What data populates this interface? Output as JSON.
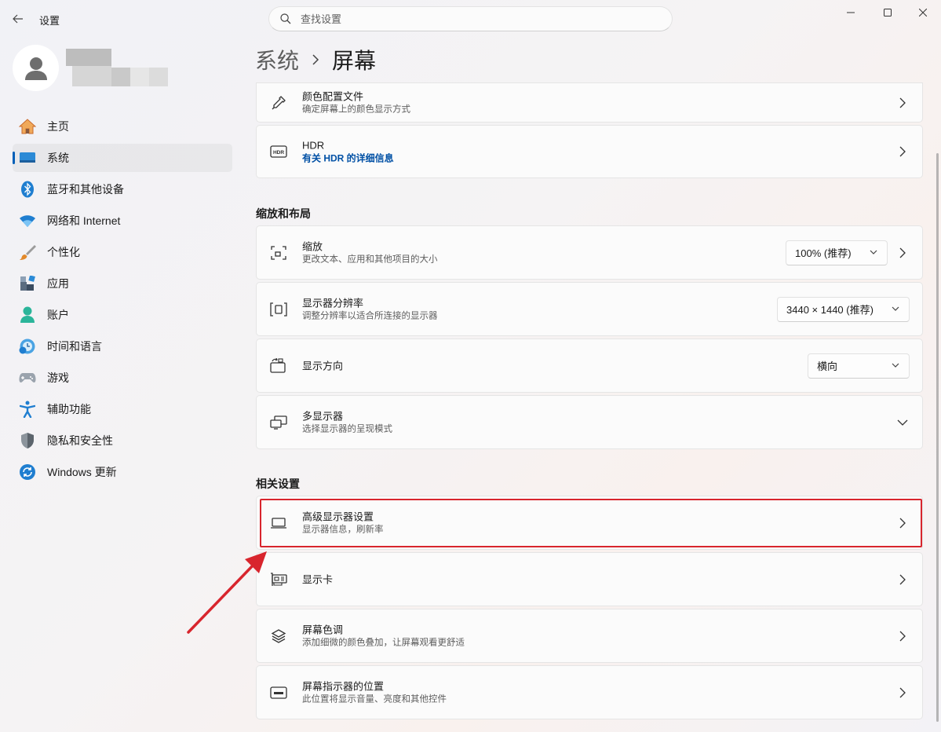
{
  "window": {
    "title": "设置"
  },
  "search": {
    "placeholder": "查找设置"
  },
  "nav": {
    "items": [
      {
        "label": "主页",
        "icon": "home-icon"
      },
      {
        "label": "系统",
        "icon": "system-icon",
        "active": true
      },
      {
        "label": "蓝牙和其他设备",
        "icon": "bluetooth-icon"
      },
      {
        "label": "网络和 Internet",
        "icon": "wifi-icon"
      },
      {
        "label": "个性化",
        "icon": "brush-icon"
      },
      {
        "label": "应用",
        "icon": "apps-icon"
      },
      {
        "label": "账户",
        "icon": "account-icon"
      },
      {
        "label": "时间和语言",
        "icon": "time-language-icon"
      },
      {
        "label": "游戏",
        "icon": "gamepad-icon"
      },
      {
        "label": "辅助功能",
        "icon": "accessibility-icon"
      },
      {
        "label": "隐私和安全性",
        "icon": "shield-icon"
      },
      {
        "label": "Windows 更新",
        "icon": "update-icon"
      }
    ]
  },
  "breadcrumb": {
    "parent": "系统",
    "current": "屏幕"
  },
  "cards": {
    "color_profile": {
      "title": "颜色配置文件",
      "subtitle": "确定屏幕上的颜色显示方式"
    },
    "hdr": {
      "title": "HDR",
      "link": "有关 HDR 的详细信息"
    }
  },
  "sections": {
    "scale_layout": "缩放和布局",
    "related": "相关设置"
  },
  "scale_layout": {
    "scale": {
      "title": "缩放",
      "subtitle": "更改文本、应用和其他项目的大小",
      "value": "100% (推荐)"
    },
    "resolution": {
      "title": "显示器分辨率",
      "subtitle": "调整分辨率以适合所连接的显示器",
      "value": "3440 × 1440 (推荐)"
    },
    "orientation": {
      "title": "显示方向",
      "value": "横向"
    },
    "multi": {
      "title": "多显示器",
      "subtitle": "选择显示器的呈现模式"
    }
  },
  "related": {
    "advanced": {
      "title": "高级显示器设置",
      "subtitle": "显示器信息，刷新率"
    },
    "gpu": {
      "title": "显示卡"
    },
    "color_filter": {
      "title": "屏幕色调",
      "subtitle": "添加细微的颜色叠加，让屏幕观看更舒适"
    },
    "indicator": {
      "title": "屏幕指示器的位置",
      "subtitle": "此位置将显示音量、亮度和其他控件"
    }
  },
  "colors": {
    "accent": "#005fb8",
    "highlight": "#d8252d"
  }
}
